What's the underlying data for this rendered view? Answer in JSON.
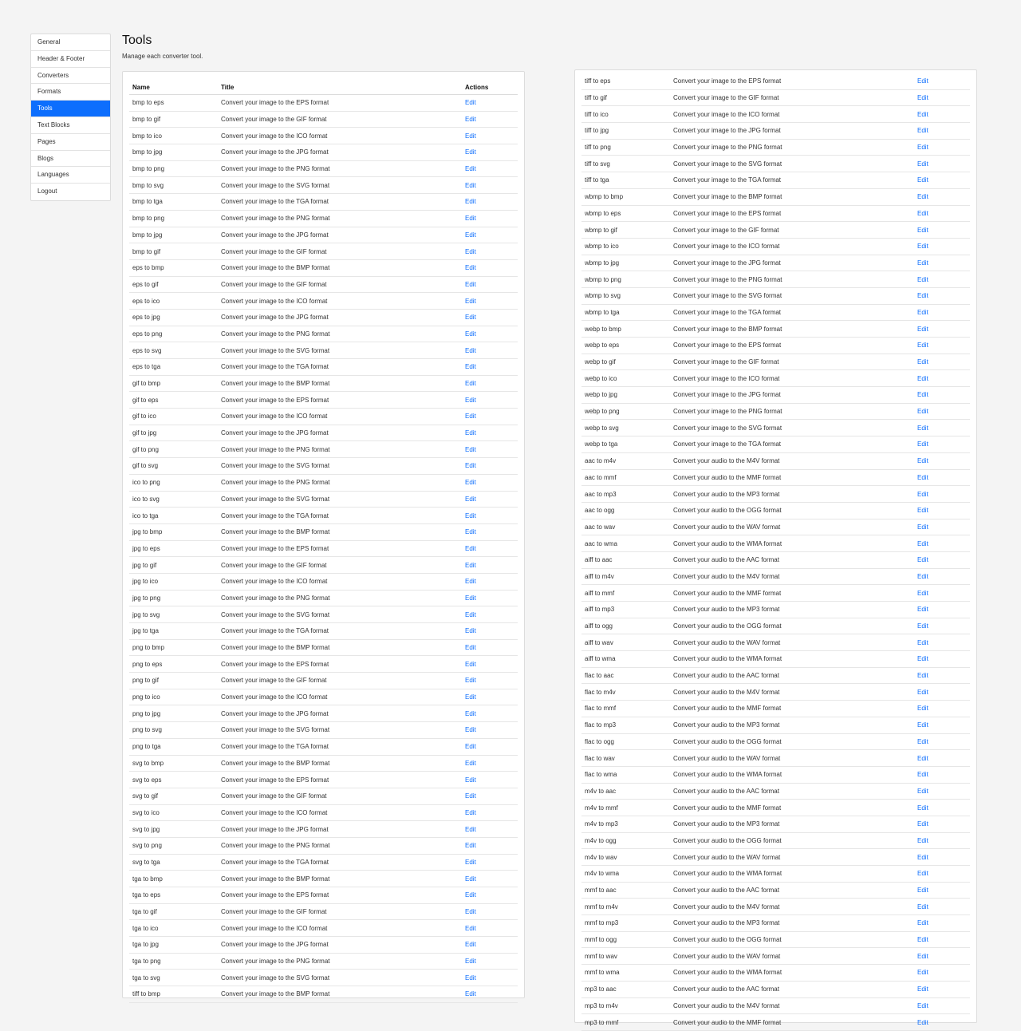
{
  "sidebar": {
    "items": [
      {
        "label": "General",
        "active": false
      },
      {
        "label": "Header & Footer",
        "active": false
      },
      {
        "label": "Converters",
        "active": false
      },
      {
        "label": "Formats",
        "active": false
      },
      {
        "label": "Tools",
        "active": true
      },
      {
        "label": "Text Blocks",
        "active": false
      },
      {
        "label": "Pages",
        "active": false
      },
      {
        "label": "Blogs",
        "active": false
      },
      {
        "label": "Languages",
        "active": false
      },
      {
        "label": "Logout",
        "active": false
      }
    ]
  },
  "header": {
    "title": "Tools",
    "subtitle": "Manage each converter tool."
  },
  "table": {
    "columns": {
      "name": "Name",
      "title": "Title",
      "actions": "Actions"
    },
    "edit_label": "Edit",
    "left_rows": [
      [
        "bmp to eps",
        "Convert your image to the EPS format"
      ],
      [
        "bmp to gif",
        "Convert your image to the GIF format"
      ],
      [
        "bmp to ico",
        "Convert your image to the ICO format"
      ],
      [
        "bmp to jpg",
        "Convert your image to the JPG format"
      ],
      [
        "bmp to png",
        "Convert your image to the PNG format"
      ],
      [
        "bmp to svg",
        "Convert your image to the SVG format"
      ],
      [
        "bmp to tga",
        "Convert your image to the TGA format"
      ],
      [
        "bmp to png",
        "Convert your image to the PNG format"
      ],
      [
        "bmp to jpg",
        "Convert your image to the JPG format"
      ],
      [
        "bmp to gif",
        "Convert your image to the GIF format"
      ],
      [
        "eps to bmp",
        "Convert your image to the BMP format"
      ],
      [
        "eps to gif",
        "Convert your image to the GIF format"
      ],
      [
        "eps to ico",
        "Convert your image to the ICO format"
      ],
      [
        "eps to jpg",
        "Convert your image to the JPG format"
      ],
      [
        "eps to png",
        "Convert your image to the PNG format"
      ],
      [
        "eps to svg",
        "Convert your image to the SVG format"
      ],
      [
        "eps to tga",
        "Convert your image to the TGA format"
      ],
      [
        "gif to bmp",
        "Convert your image to the BMP format"
      ],
      [
        "gif to eps",
        "Convert your image to the EPS format"
      ],
      [
        "gif to ico",
        "Convert your image to the ICO format"
      ],
      [
        "gif to jpg",
        "Convert your image to the JPG format"
      ],
      [
        "gif to png",
        "Convert your image to the PNG format"
      ],
      [
        "gif to svg",
        "Convert your image to the SVG format"
      ],
      [
        "ico to png",
        "Convert your image to the PNG format"
      ],
      [
        "ico to svg",
        "Convert your image to the SVG format"
      ],
      [
        "ico to tga",
        "Convert your image to the TGA format"
      ],
      [
        "jpg to bmp",
        "Convert your image to the BMP format"
      ],
      [
        "jpg to eps",
        "Convert your image to the EPS format"
      ],
      [
        "jpg to gif",
        "Convert your image to the GIF format"
      ],
      [
        "jpg to ico",
        "Convert your image to the ICO format"
      ],
      [
        "jpg to png",
        "Convert your image to the PNG format"
      ],
      [
        "jpg to svg",
        "Convert your image to the SVG format"
      ],
      [
        "jpg to tga",
        "Convert your image to the TGA format"
      ],
      [
        "png to bmp",
        "Convert your image to the BMP format"
      ],
      [
        "png to eps",
        "Convert your image to the EPS format"
      ],
      [
        "png to gif",
        "Convert your image to the GIF format"
      ],
      [
        "png to ico",
        "Convert your image to the ICO format"
      ],
      [
        "png to jpg",
        "Convert your image to the JPG format"
      ],
      [
        "png to svg",
        "Convert your image to the SVG format"
      ],
      [
        "png to tga",
        "Convert your image to the TGA format"
      ],
      [
        "svg to bmp",
        "Convert your image to the BMP format"
      ],
      [
        "svg to eps",
        "Convert your image to the EPS format"
      ],
      [
        "svg to gif",
        "Convert your image to the GIF format"
      ],
      [
        "svg to ico",
        "Convert your image to the ICO format"
      ],
      [
        "svg to jpg",
        "Convert your image to the JPG format"
      ],
      [
        "svg to png",
        "Convert your image to the PNG format"
      ],
      [
        "svg to tga",
        "Convert your image to the TGA format"
      ],
      [
        "tga to bmp",
        "Convert your image to the BMP format"
      ],
      [
        "tga to eps",
        "Convert your image to the EPS format"
      ],
      [
        "tga to gif",
        "Convert your image to the GIF format"
      ],
      [
        "tga to ico",
        "Convert your image to the ICO format"
      ],
      [
        "tga to jpg",
        "Convert your image to the JPG format"
      ],
      [
        "tga to png",
        "Convert your image to the PNG format"
      ],
      [
        "tga to svg",
        "Convert your image to the SVG format"
      ],
      [
        "tiff to bmp",
        "Convert your image to the BMP format"
      ]
    ],
    "right_rows": [
      [
        "tiff to eps",
        "Convert your image to the EPS format"
      ],
      [
        "tiff to gif",
        "Convert your image to the GIF format"
      ],
      [
        "tiff to ico",
        "Convert your image to the ICO format"
      ],
      [
        "tiff to jpg",
        "Convert your image to the JPG format"
      ],
      [
        "tiff to png",
        "Convert your image to the PNG format"
      ],
      [
        "tiff to svg",
        "Convert your image to the SVG format"
      ],
      [
        "tiff to tga",
        "Convert your image to the TGA format"
      ],
      [
        "wbmp to bmp",
        "Convert your image to the BMP format"
      ],
      [
        "wbmp to eps",
        "Convert your image to the EPS format"
      ],
      [
        "wbmp to gif",
        "Convert your image to the GIF format"
      ],
      [
        "wbmp to ico",
        "Convert your image to the ICO format"
      ],
      [
        "wbmp to jpg",
        "Convert your image to the JPG format"
      ],
      [
        "wbmp to png",
        "Convert your image to the PNG format"
      ],
      [
        "wbmp to svg",
        "Convert your image to the SVG format"
      ],
      [
        "wbmp to tga",
        "Convert your image to the TGA format"
      ],
      [
        "webp to bmp",
        "Convert your image to the BMP format"
      ],
      [
        "webp to eps",
        "Convert your image to the EPS format"
      ],
      [
        "webp to gif",
        "Convert your image to the GIF format"
      ],
      [
        "webp to ico",
        "Convert your image to the ICO format"
      ],
      [
        "webp to jpg",
        "Convert your image to the JPG format"
      ],
      [
        "webp to png",
        "Convert your image to the PNG format"
      ],
      [
        "webp to svg",
        "Convert your image to the SVG format"
      ],
      [
        "webp to tga",
        "Convert your image to the TGA format"
      ],
      [
        "aac to m4v",
        "Convert your audio to the M4V format"
      ],
      [
        "aac to mmf",
        "Convert your audio to the MMF format"
      ],
      [
        "aac to mp3",
        "Convert your audio to the MP3 format"
      ],
      [
        "aac to ogg",
        "Convert your audio to the OGG format"
      ],
      [
        "aac to wav",
        "Convert your audio to the WAV format"
      ],
      [
        "aac to wma",
        "Convert your audio to the WMA format"
      ],
      [
        "aiff to aac",
        "Convert your audio to the AAC format"
      ],
      [
        "aiff to m4v",
        "Convert your audio to the M4V format"
      ],
      [
        "aiff to mmf",
        "Convert your audio to the MMF format"
      ],
      [
        "aiff to mp3",
        "Convert your audio to the MP3 format"
      ],
      [
        "aiff to ogg",
        "Convert your audio to the OGG format"
      ],
      [
        "aiff to wav",
        "Convert your audio to the WAV format"
      ],
      [
        "aiff to wma",
        "Convert your audio to the WMA format"
      ],
      [
        "flac to aac",
        "Convert your audio to the AAC format"
      ],
      [
        "flac to m4v",
        "Convert your audio to the M4V format"
      ],
      [
        "flac to mmf",
        "Convert your audio to the MMF format"
      ],
      [
        "flac to mp3",
        "Convert your audio to the MP3 format"
      ],
      [
        "flac to ogg",
        "Convert your audio to the OGG format"
      ],
      [
        "flac to wav",
        "Convert your audio to the WAV format"
      ],
      [
        "flac to wma",
        "Convert your audio to the WMA format"
      ],
      [
        "m4v to aac",
        "Convert your audio to the AAC format"
      ],
      [
        "m4v to mmf",
        "Convert your audio to the MMF format"
      ],
      [
        "m4v to mp3",
        "Convert your audio to the MP3 format"
      ],
      [
        "m4v to ogg",
        "Convert your audio to the OGG format"
      ],
      [
        "m4v to wav",
        "Convert your audio to the WAV format"
      ],
      [
        "m4v to wma",
        "Convert your audio to the WMA format"
      ],
      [
        "mmf to aac",
        "Convert your audio to the AAC format"
      ],
      [
        "mmf to m4v",
        "Convert your audio to the M4V format"
      ],
      [
        "mmf to mp3",
        "Convert your audio to the MP3 format"
      ],
      [
        "mmf to ogg",
        "Convert your audio to the OGG format"
      ],
      [
        "mmf to wav",
        "Convert your audio to the WAV format"
      ],
      [
        "mmf to wma",
        "Convert your audio to the WMA format"
      ],
      [
        "mp3 to aac",
        "Convert your audio to the AAC format"
      ],
      [
        "mp3 to m4v",
        "Convert your audio to the M4V format"
      ],
      [
        "mp3 to mmf",
        "Convert your audio to the MMF format"
      ]
    ]
  }
}
